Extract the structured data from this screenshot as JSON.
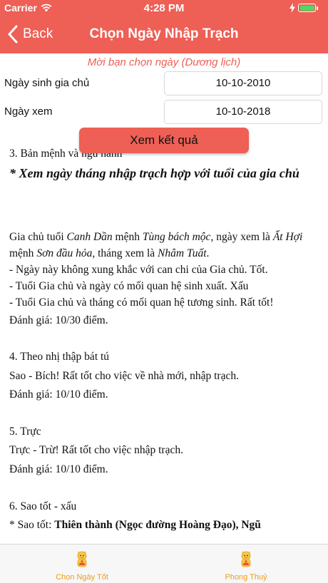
{
  "status_bar": {
    "carrier": "Carrier",
    "time": "4:28 PM",
    "battery_color": "#4cd964"
  },
  "nav": {
    "back_label": "Back",
    "title": "Chọn Ngày Nhập Trạch",
    "bar_color": "#ee5f55"
  },
  "form": {
    "prompt": "Mời bạn chọn ngày (Dương lịch)",
    "birth_label": "Ngày sinh gia chủ",
    "birth_value": "10-10-2010",
    "view_label": "Ngày xem",
    "view_value": "10-10-2018",
    "submit_label": "Xem kết quả"
  },
  "result": {
    "clipped_line": "3. Bản mệnh và ngũ hành",
    "heading": "* Xem ngày tháng nhập trạch hợp với tuổi của gia chủ",
    "p1_a": "Gia chủ tuổi ",
    "p1_b": "Canh Dần",
    "p1_c": " mệnh ",
    "p1_d": "Tùng bách mộc",
    "p1_e": ", ngày xem là ",
    "p1_f": "Ất Hợi",
    "p1_g": " mệnh ",
    "p1_h": "Sơn đầu hỏa",
    "p1_i": ", tháng xem là ",
    "p1_j": "Nhâm Tuất",
    "p1_k": ".",
    "p1_l1": "- Ngày này không xung khắc với can chi của Gia chủ. Tốt.",
    "p1_l2": "- Tuổi Gia chủ và ngày có mối quan hệ sinh xuất. Xấu",
    "p1_l3": "- Tuổi Gia chủ và tháng có mối quan hệ tương sinh. Rất tốt!",
    "p1_score": "Đánh giá: 10/30 điểm.",
    "s4_title": "4. Theo nhị thập bát tú",
    "s4_body": "Sao - Bích! Rất tốt cho việc về nhà mới, nhập trạch.",
    "s4_score": "Đánh giá: 10/10 điểm.",
    "s5_title": "5. Trực",
    "s5_body": "Trực - Trừ! Rất tốt cho việc nhập trạch.",
    "s5_score": "Đánh giá: 10/10 điểm.",
    "s6_title": "6. Sao tốt - xấu",
    "s6_prefix": "* Sao tốt: ",
    "s6_bold": "Thiên thành (Ngọc đường Hoàng Đạo), Ngũ"
  },
  "tabs": [
    {
      "label": "Chọn Ngày Tốt",
      "icon": "lucky-cat-icon"
    },
    {
      "label": "Phong Thuỷ",
      "icon": "lucky-cat-icon"
    }
  ],
  "tab_color": "#ee9b1d"
}
